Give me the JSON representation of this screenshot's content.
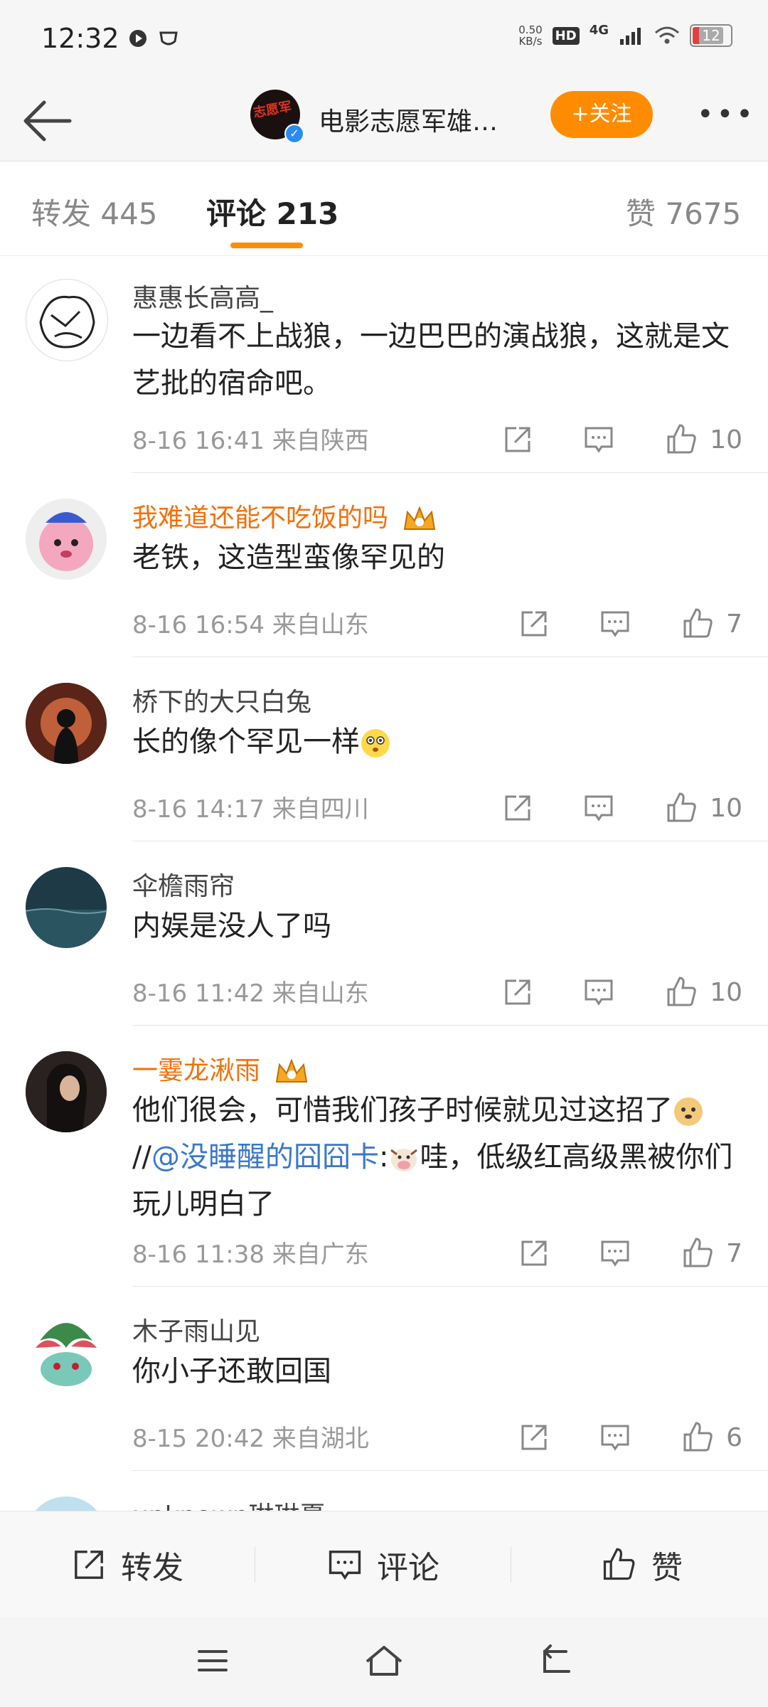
{
  "status_bar": {
    "time": "12:32",
    "net_speed_value": "0.50",
    "net_speed_unit": "KB/s",
    "hd_label": "HD",
    "network": "4G",
    "battery": "12"
  },
  "header": {
    "account_name": "电影志愿军雄…",
    "avatar_logo_text": "志愿军",
    "follow_label": "+关注",
    "more_label": "•••"
  },
  "tabs": {
    "repost": "转发 445",
    "comment": "评论 213",
    "like": "赞 7675"
  },
  "comments": [
    {
      "user": "惠惠长高高_",
      "vip": false,
      "text": "一边看不上战狼，一边巴巴的演战狼，这就是文艺批的宿命吧。",
      "time": "8-16 16:41",
      "location": "来自陕西",
      "likes": "10"
    },
    {
      "user": "我难道还能不吃饭的吗",
      "vip": true,
      "text": "老铁，这造型蛮像罕见的",
      "time": "8-16 16:54",
      "location": "来自山东",
      "likes": "7"
    },
    {
      "user": "桥下的大只白兔",
      "vip": false,
      "text": "长的像个罕见一样",
      "emoji": "flushed-emoji",
      "time": "8-16 14:17",
      "location": "来自四川",
      "likes": "10"
    },
    {
      "user": "伞檐雨帘",
      "vip": false,
      "text": "内娱是没人了吗",
      "time": "8-16 11:42",
      "location": "来自山东",
      "likes": "10"
    },
    {
      "user": "一霎龙湫雨",
      "vip": true,
      "text_part1": "他们很会，可惜我们孩子时候就见过这招了",
      "text_part2": "//",
      "mention": "@没睡醒的囧囧卡",
      "text_part3": ":",
      "text_part4": "哇，低级红高级黑被你们玩儿明白了",
      "time": "8-16 11:38",
      "location": "来自广东",
      "likes": "7"
    },
    {
      "user": "木子雨山见",
      "vip": false,
      "text": "你小子还敢回国",
      "time": "8-15 20:42",
      "location": "来自湖北",
      "likes": "6"
    },
    {
      "user": "unknown琳琳夏"
    }
  ],
  "bottom_bar": {
    "repost": "转发",
    "comment": "评论",
    "like": "赞"
  },
  "colors": {
    "accent": "#ff8c00",
    "vip_name": "#f2700a",
    "mention": "#3a78c8"
  }
}
